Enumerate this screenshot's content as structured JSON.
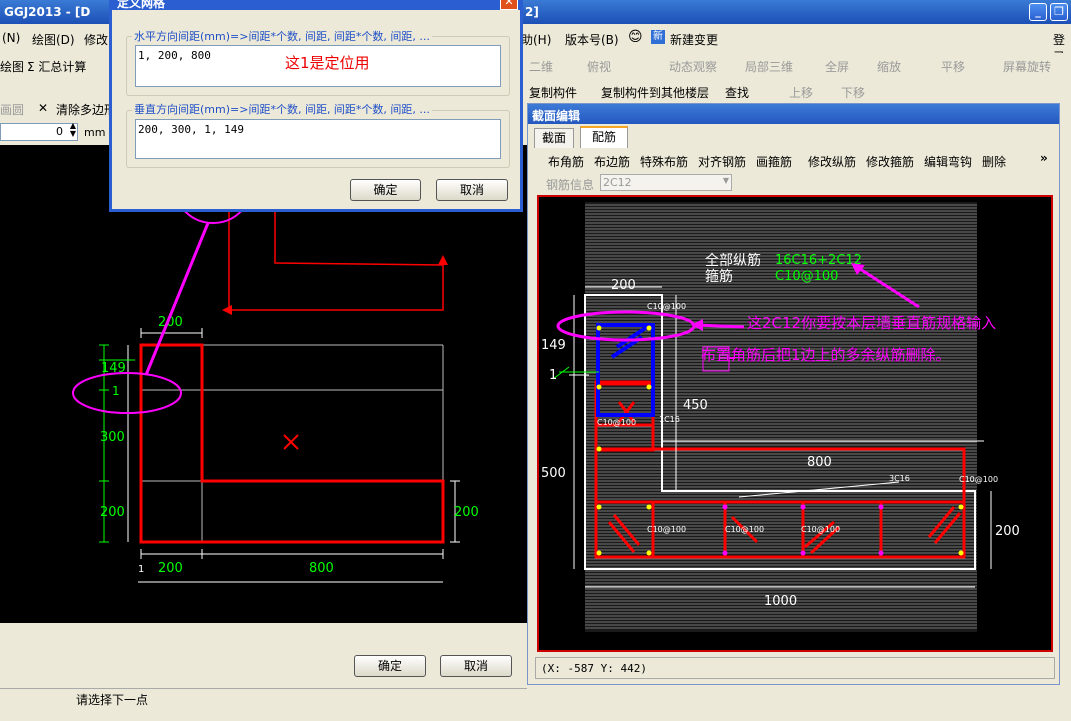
{
  "app": {
    "title_left": "GGJ2013 - [D",
    "title_right": "2]",
    "login": "登录"
  },
  "menu": {
    "left": [
      "(N)",
      "绘图(D)",
      "修改"
    ],
    "right": [
      "助(H)",
      "版本号(B)",
      "新建变更"
    ]
  },
  "toolbar_left": {
    "item1": "绘图",
    "item2": "Σ 汇总计算",
    "item3": "画圆",
    "item4": "清除多边形",
    "offset_value": "0",
    "offset_unit": "mm"
  },
  "toolbar_right1": {
    "view": "二维",
    "top": "俯视",
    "orbit": "动态观察",
    "local3d": "局部三维",
    "fullscreen": "全屏",
    "zoom": "缩放",
    "pan": "平移",
    "rotate": "屏幕旋转"
  },
  "toolbar_right2": {
    "copy_member": "复制构件",
    "copy_floor": "复制构件到其他楼层",
    "find": "查找",
    "up": "上移",
    "down": "下移"
  },
  "dialog": {
    "title": "定义网格",
    "h_label": "水平方向间距(mm)=>间距*个数, 间距, 间距*个数, 间距, ...",
    "h_value": "1, 200, 800",
    "h_note": "这1是定位用",
    "v_label": "垂直方向间距(mm)=>间距*个数, 间距, 间距*个数, 间距, ...",
    "v_value": "200, 300, 1, 149",
    "ok": "确定",
    "cancel": "取消"
  },
  "left_canvas": {
    "dim_top": "200",
    "dim_bottom_left": "200",
    "dim_bottom_right": "800",
    "dim_left_149": "149",
    "dim_left_1": "1",
    "dim_left_300": "300",
    "dim_left_200": "200",
    "dim_right_200": "200",
    "tick_1": "1"
  },
  "left_bottom": {
    "ok": "确定",
    "cancel": "取消",
    "status": "请选择下一点"
  },
  "right_window": {
    "title": "截面编辑",
    "tabs": [
      "截面",
      "配筋"
    ],
    "tools": [
      "布角筋",
      "布边筋",
      "特殊布筋",
      "对齐钢筋",
      "画箍筋",
      "修改纵筋",
      "修改箍筋",
      "编辑弯钩",
      "删除"
    ],
    "more": "»",
    "rebar_info_label": "钢筋信息",
    "rebar_info_value": "2C12",
    "coords": "(X: -587 Y: 442)"
  },
  "right_canvas": {
    "all_long_bar": "全部纵筋",
    "stirrup": "箍筋",
    "long_bar_value": "16C16+2C12",
    "stirrup_value": "C10@100",
    "note1": "这2C12你要按本层墙垂直筋规格输入",
    "note2": "布置角筋后把1边上的多余纵筋删除。",
    "dim_200_top": "200",
    "dim_149": "149",
    "dim_1": "1",
    "dim_450": "450",
    "dim_800": "800",
    "dim_500": "500",
    "dim_200_right": "200",
    "dim_1000": "1000",
    "label_c10_1": "C10@100",
    "label_c10_2": "C10@100",
    "label_c10_3": "C10@100",
    "label_c10_4": "C10@100",
    "label_c10_5": "C10@100",
    "label_c10_6": "C10@100",
    "label_1c16": "1C16",
    "label_3c16": "3C16"
  }
}
